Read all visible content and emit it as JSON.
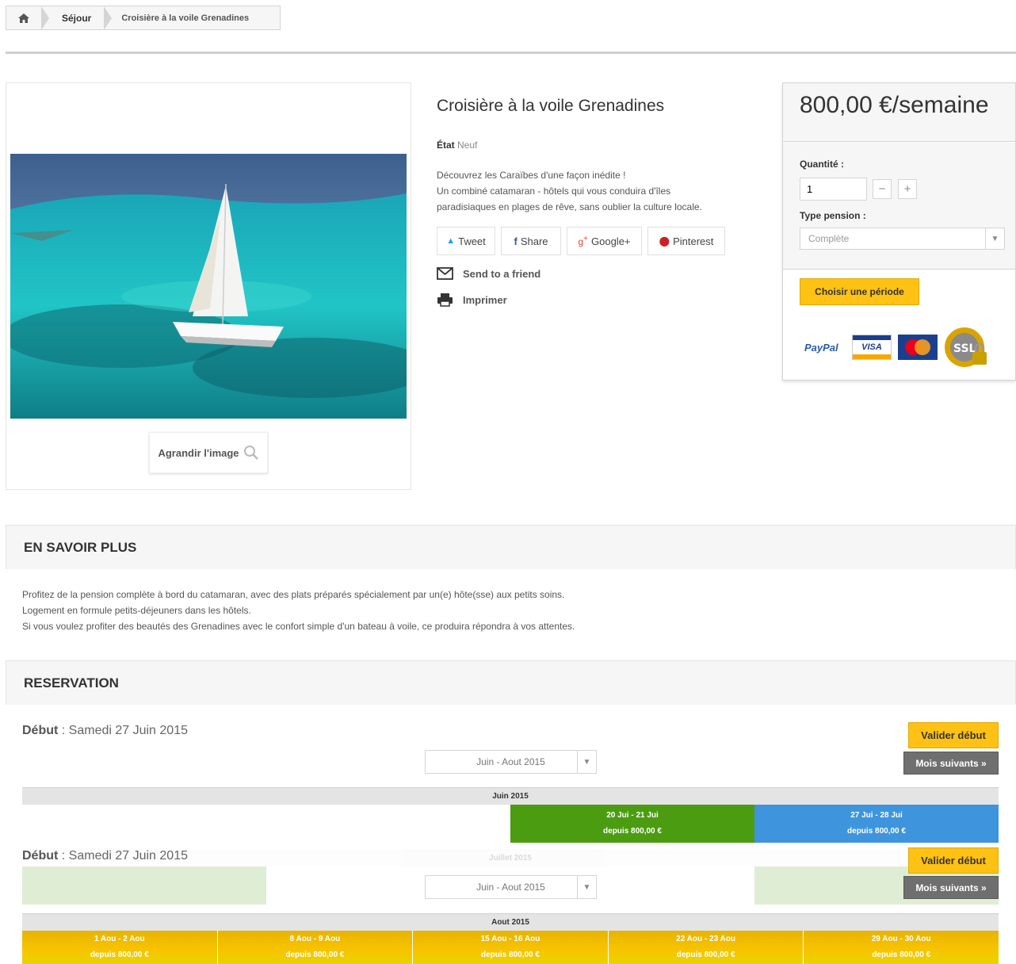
{
  "breadcrumb": {
    "home": "home",
    "items": [
      "Séjour",
      "Croisière à la voile Grenadines"
    ]
  },
  "product": {
    "title": "Croisière à la voile Grenadines",
    "etat_label": "État",
    "etat_value": "Neuf",
    "description": [
      "Découvrez les Caraïbes d'une façon inédite !",
      "Un combiné catamaran - hôtels qui vous conduira d'îles",
      "paradisiaques en plages de rêve, sans oublier la culture locale."
    ],
    "zoom_label": "Agrandir l'image",
    "share": [
      "Tweet",
      "Share",
      "Google+",
      "Pinterest"
    ],
    "send_friend": "Send to a friend",
    "print": "Imprimer"
  },
  "buy_box": {
    "price": "800,00 €/semaine",
    "quantity_label": "Quantité :",
    "quantity_value": "1",
    "minus": "−",
    "plus": "+",
    "pension_label": "Type pension :",
    "pension_value": "Complète",
    "choose_button": "Choisir une période",
    "payment_icons": [
      "paypal-icon",
      "visa-icon",
      "mastercard-icon",
      "ssl-lock-icon"
    ]
  },
  "en_savoir_plus": {
    "title": "EN SAVOIR PLUS",
    "lines": [
      "Profitez de la pension complète à bord du catamaran, avec des plats préparés spécialement par un(e) hôte(sse) aux petits soins.",
      "Logement en formule petits-déjeuners dans les hôtels.",
      "Si vous voulez profiter des beautés des Grenadines avec le confort simple d'un bateau à voile, ce produira répondra à vos attentes."
    ]
  },
  "reservation": {
    "title": "RESERVATION",
    "debut_label": "Début",
    "debut_value": " : Samedi 27 Juin 2015",
    "period_select": "Juin - Aout 2015",
    "validate_button": "Valider début",
    "next_months_button": "Mois suivants »",
    "month1": "Juin 2015",
    "month1_weeks": [
      {
        "dates": "20 Jui - 21 Jui",
        "price": "depuis 800,00 €",
        "color": "#4c9c12"
      },
      {
        "dates": "27 Jui - 28 Jui",
        "price": "depuis 800,00 €",
        "color": "#3e95dd"
      }
    ],
    "month2": "Juillet 2015",
    "month3": "Aout 2015",
    "month3_weeks": [
      {
        "dates": "1 Aou - 2 Aou",
        "price": "depuis 800,00 €"
      },
      {
        "dates": "8 Aou - 9 Aou",
        "price": "depuis 800,00 €"
      },
      {
        "dates": "15 Aou - 16 Aou",
        "price": "depuis 800,00 €"
      },
      {
        "dates": "22 Aou - 23 Aou",
        "price": "depuis 800,00 €"
      },
      {
        "dates": "29 Aou - 30 Aou",
        "price": "depuis 800,00 €"
      }
    ]
  }
}
